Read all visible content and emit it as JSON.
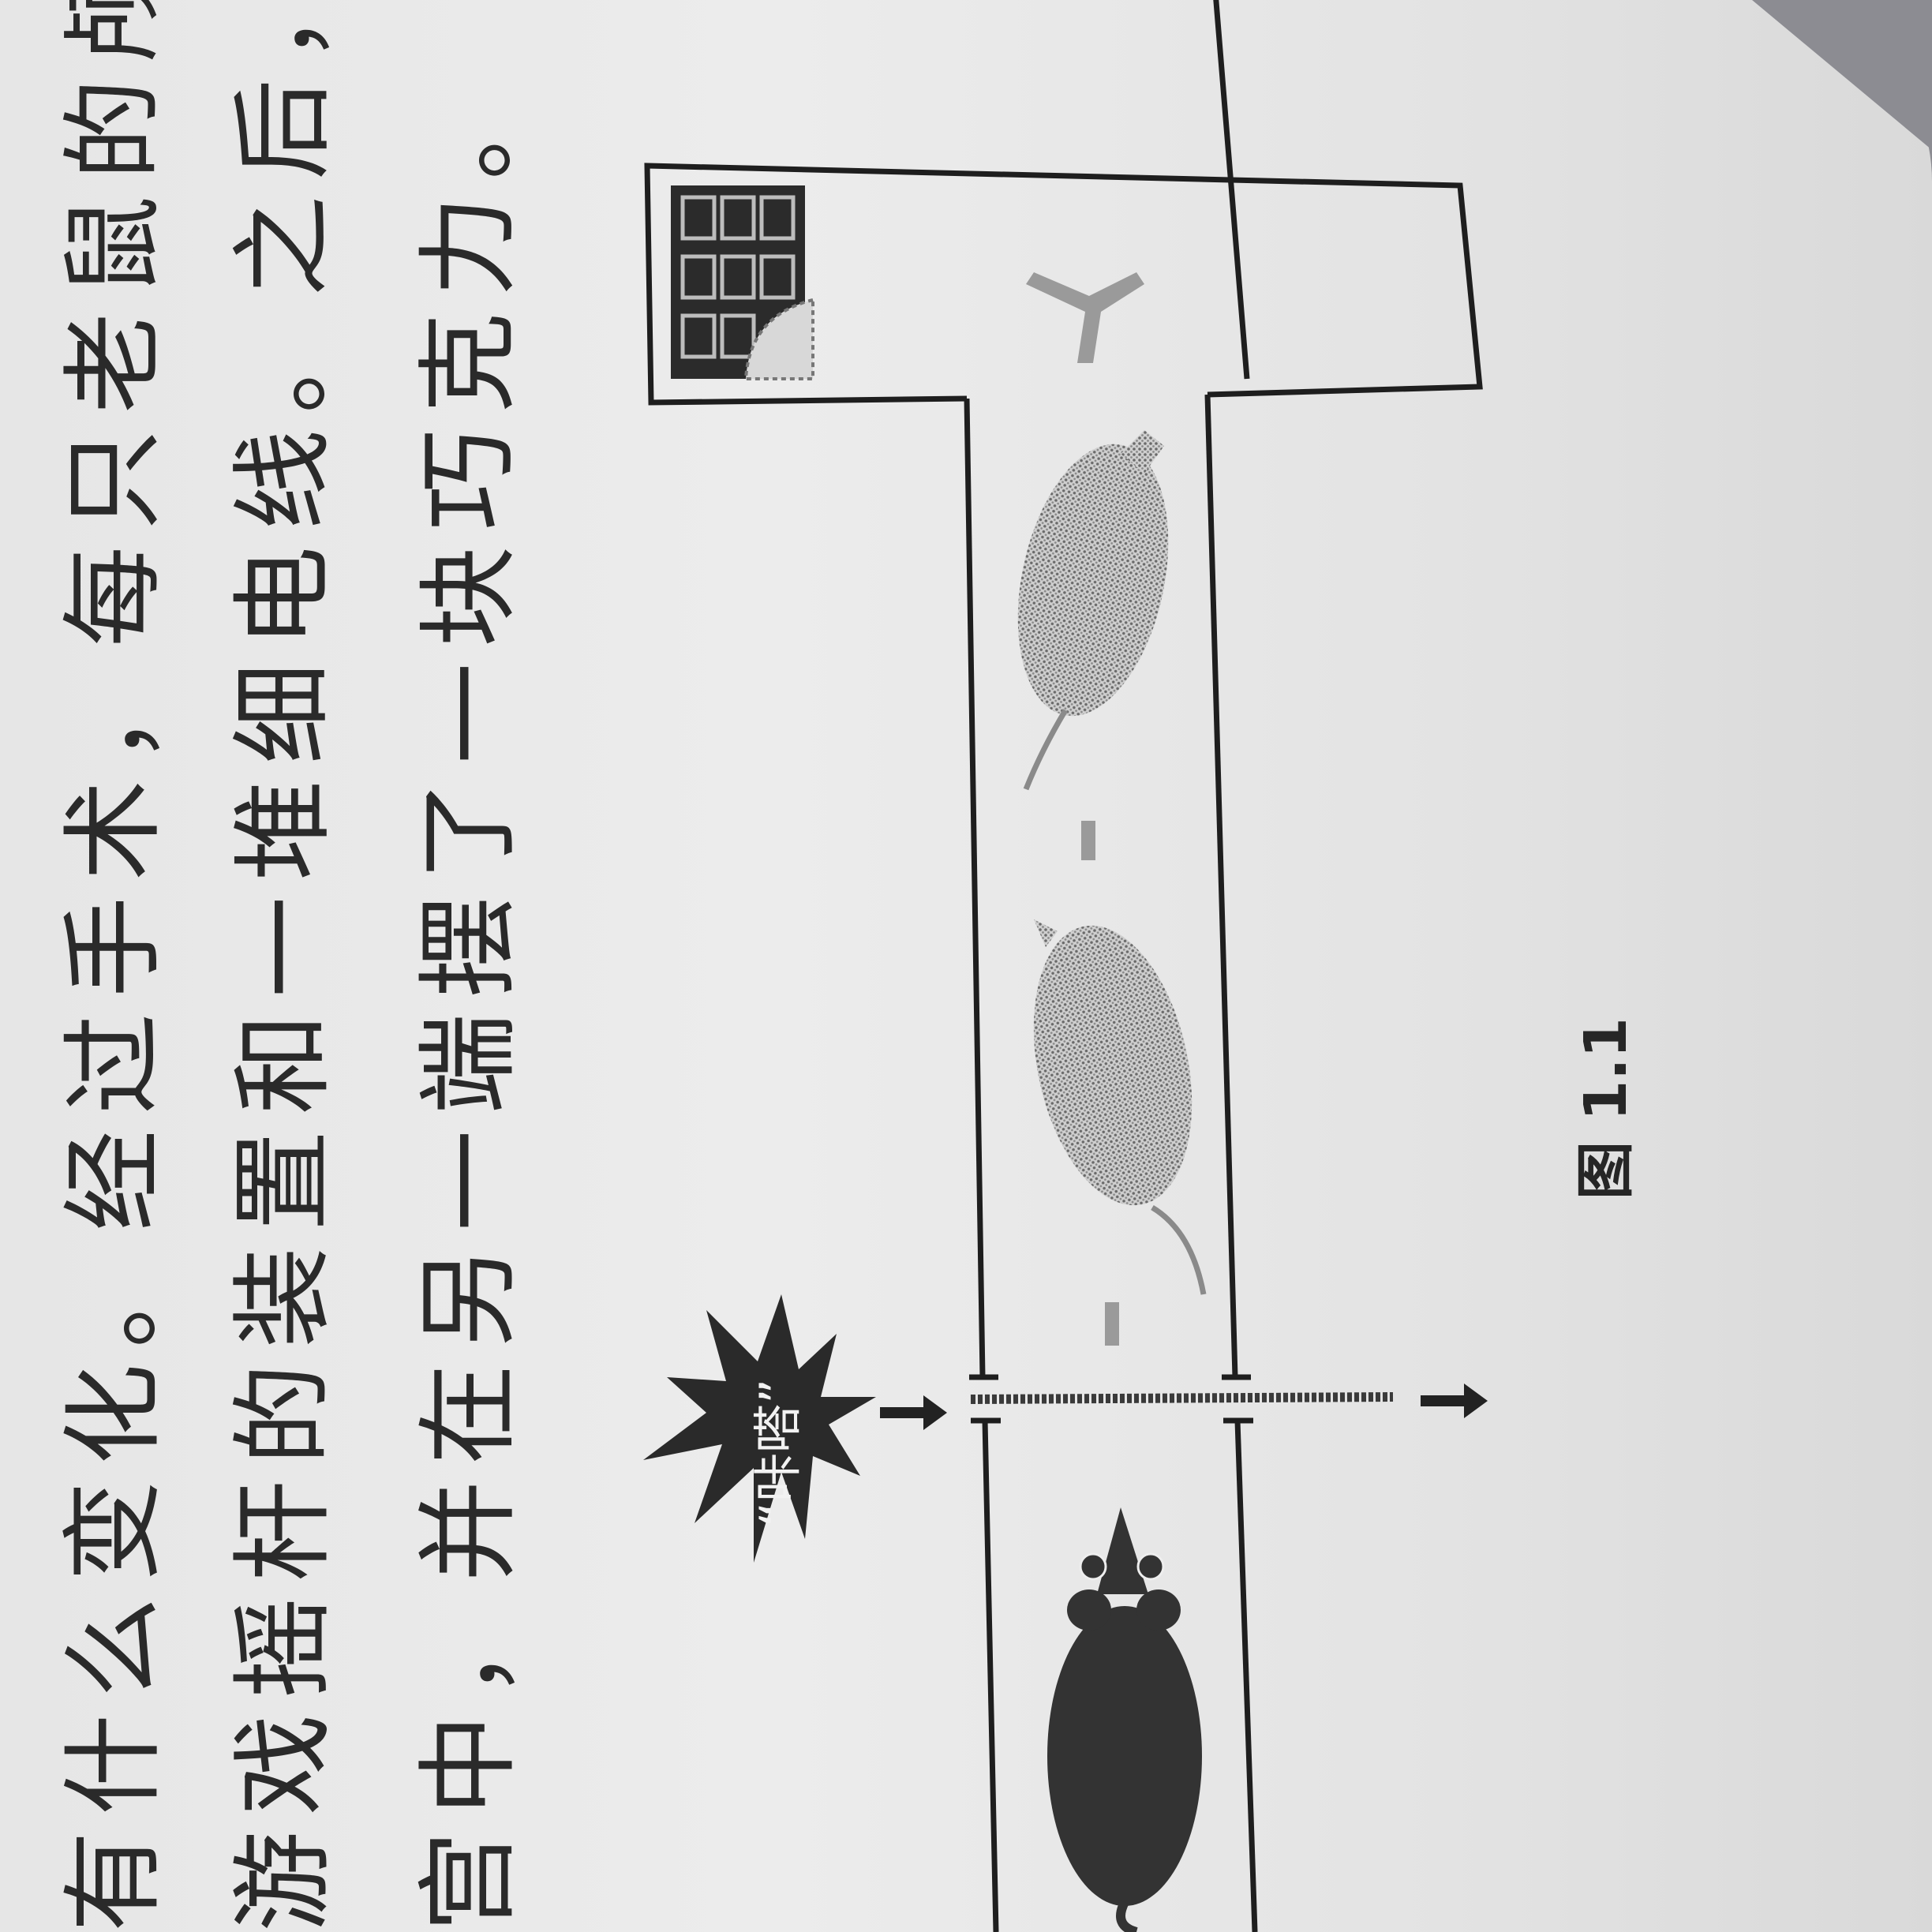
{
  "paragraph": {
    "line1": "有什么变化。经过手术，每只老鼠的颅腔中都被植",
    "line2": "游戏摇杆的装置和一堆细电线。之后，研究人员将",
    "line3": "宫中，并在另一端摆了一块巧克力。"
  },
  "figure": {
    "click_sound": "“咔嗒”",
    "caption": "图 1.1"
  }
}
